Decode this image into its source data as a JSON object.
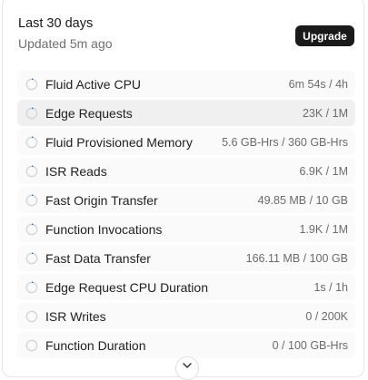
{
  "header": {
    "title": "Last 30 days",
    "subtitle": "Updated 5m ago",
    "upgrade_label": "Upgrade"
  },
  "colors": {
    "accent": "#0070f3",
    "ring_track": "#d4d4d4",
    "button_bg": "#1a1a1a"
  },
  "usage": [
    {
      "label": "Fluid Active CPU",
      "value": "6m 54s / 4h",
      "fraction": 0.029
    },
    {
      "label": "Edge Requests",
      "value": "23K / 1M",
      "fraction": 0.023
    },
    {
      "label": "Fluid Provisioned Memory",
      "value": "5.6 GB-Hrs / 360 GB-Hrs",
      "fraction": 0.016
    },
    {
      "label": "ISR Reads",
      "value": "6.9K / 1M",
      "fraction": 0.007
    },
    {
      "label": "Fast Origin Transfer",
      "value": "49.85 MB / 10 GB",
      "fraction": 0.005
    },
    {
      "label": "Function Invocations",
      "value": "1.9K / 1M",
      "fraction": 0.002
    },
    {
      "label": "Fast Data Transfer",
      "value": "166.11 MB / 100 GB",
      "fraction": 0.002
    },
    {
      "label": "Edge Request CPU Duration",
      "value": "1s / 1h",
      "fraction": 0.0003
    },
    {
      "label": "ISR Writes",
      "value": "0 / 200K",
      "fraction": 0
    },
    {
      "label": "Function Duration",
      "value": "0 / 100 GB-Hrs",
      "fraction": 0
    }
  ],
  "scroll_icon": "chevron-down-icon"
}
